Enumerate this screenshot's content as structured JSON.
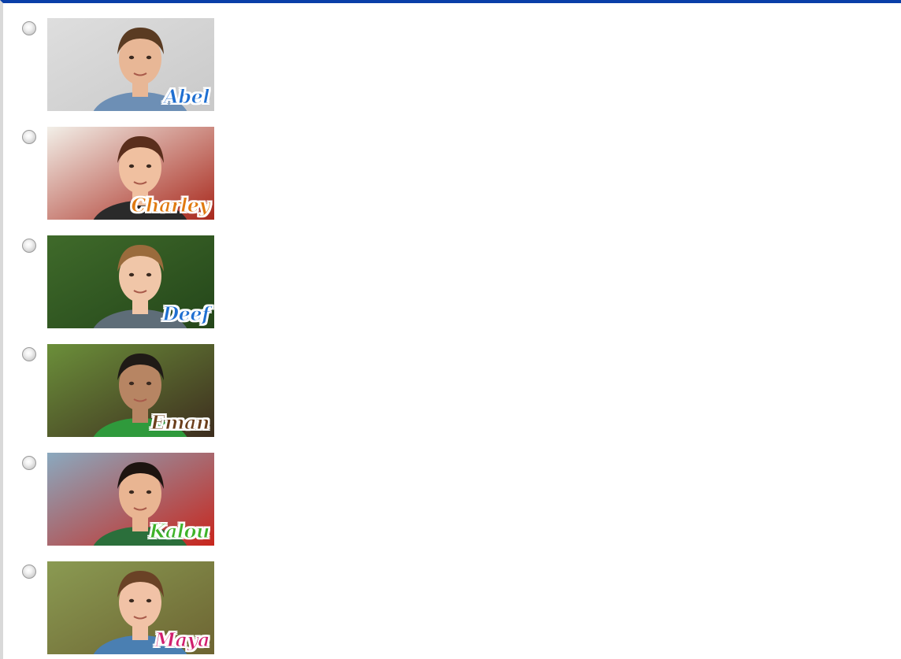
{
  "options": [
    {
      "name": "Abel",
      "color": "#1f6fd1",
      "bg": [
        "#dedede",
        "#c9c9c9"
      ],
      "skin": "#e8b796",
      "hair": "#5a3b22",
      "shirt": "#6d8fb5"
    },
    {
      "name": "Charley",
      "color": "#e07a10",
      "bg": [
        "#f2efe8",
        "#a8281c"
      ],
      "skin": "#f0c0a0",
      "hair": "#5a2e1c",
      "shirt": "#2a2a2a"
    },
    {
      "name": "Deef",
      "color": "#1f6fd1",
      "bg": [
        "#3f6a2a",
        "#24461a"
      ],
      "skin": "#f0c6a8",
      "hair": "#9a6b3c",
      "shirt": "#5e6d78"
    },
    {
      "name": "Eman",
      "color": "#6b3f1c",
      "bg": [
        "#6b8f3a",
        "#3d2d1e"
      ],
      "skin": "#b78563",
      "hair": "#1f1a16",
      "shirt": "#2f9a3c"
    },
    {
      "name": "Kalou",
      "color": "#3fb32a",
      "bg": [
        "#8aa9bf",
        "#c8261d"
      ],
      "skin": "#e9b592",
      "hair": "#1d1410",
      "shirt": "#2b6f3b"
    },
    {
      "name": "Maya",
      "color": "#d11f6f",
      "bg": [
        "#8a9a52",
        "#6d6432"
      ],
      "skin": "#f1c2a6",
      "hair": "#6a4226",
      "shirt": "#4a7fb2"
    }
  ]
}
